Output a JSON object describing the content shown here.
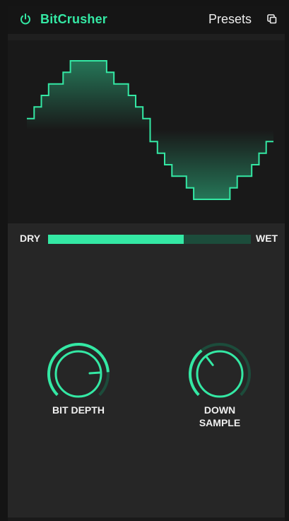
{
  "header": {
    "title": "BitCrusher",
    "presets_label": "Presets",
    "power_icon": "power-icon",
    "copy_icon": "copy-icon"
  },
  "mix": {
    "dry_label": "DRY",
    "wet_label": "WET",
    "value": 0.67
  },
  "knobs": [
    {
      "label": "BIT DEPTH",
      "value": 0.82
    },
    {
      "label": "DOWN\nSAMPLE",
      "value": 0.36
    }
  ],
  "waveform": {
    "type": "bitcrushed-sine",
    "quantization_levels": 13,
    "samples_per_cycle": 34
  },
  "colors": {
    "accent": "#34e8a4",
    "track_dark": "#1c4c3b",
    "panel": "#262626",
    "background": "#141414",
    "text": "#f0f0f0"
  }
}
